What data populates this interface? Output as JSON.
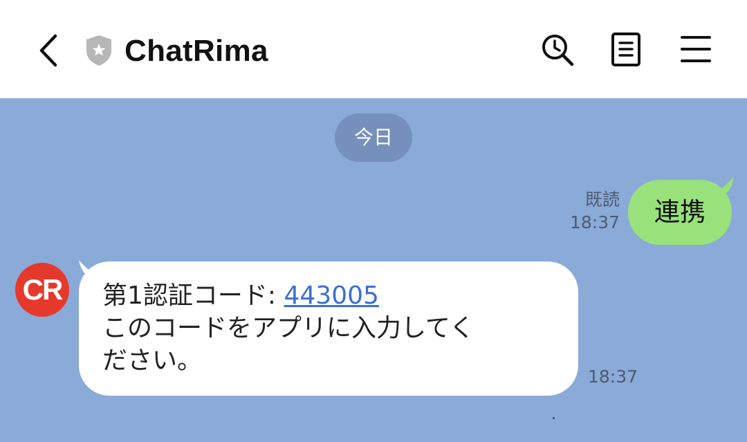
{
  "header": {
    "title": "ChatRima",
    "icons": {
      "back": "chevron-left-icon",
      "verified": "shield-star-icon",
      "search": "search-history-icon",
      "notes": "notes-icon",
      "menu": "hamburger-menu-icon"
    }
  },
  "chat": {
    "date_label": "今日",
    "outgoing": {
      "read_label": "既読",
      "time": "18:37",
      "text": "連携"
    },
    "incoming": {
      "avatar_text": "CR",
      "line1_prefix": "第1認証コード: ",
      "code": "443005",
      "line2": "このコードをアプリに入力してく",
      "line3": "ださい。",
      "time": "18:37"
    }
  },
  "colors": {
    "chat_background": "#8aaad8",
    "outgoing_bubble": "#99e27b",
    "incoming_bubble": "#ffffff",
    "avatar": "#e53a2b",
    "link": "#3b6fd0",
    "date_pill": "#7690bd"
  }
}
